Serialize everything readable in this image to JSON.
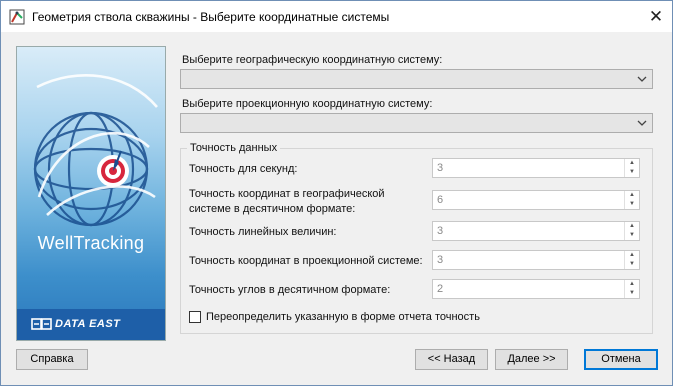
{
  "window": {
    "title": "Геометрия ствола скважины - Выберите координатные системы",
    "close_glyph": "✕"
  },
  "banner": {
    "brand": "WellTracking",
    "footer_logo": "DATA EAST"
  },
  "form": {
    "geo_label": "Выберите географическую координатную систему:",
    "geo_value": "",
    "proj_label": "Выберите проекционную координатную систему:",
    "proj_value": "",
    "group_title": "Точность данных",
    "fields": [
      {
        "label": "Точность для секунд:",
        "value": "3"
      },
      {
        "label": "Точность координат в географической",
        "label2": "системе в десятичном формате:",
        "value": "6"
      },
      {
        "label": "Точность линейных величин:",
        "value": "3"
      },
      {
        "label": "Точность координат в проекционной системе:",
        "value": "3"
      },
      {
        "label": "Точность углов в десятичном формате:",
        "value": "2"
      }
    ],
    "override_label": "Переопределить указанную в форме отчета точность",
    "override_checked": false
  },
  "buttons": {
    "help": "Справка",
    "back": "<< Назад",
    "next": "Далее >>",
    "cancel": "Отмена"
  },
  "colors": {
    "accent": "#0078d7",
    "banner_footer": "#1e5fa8",
    "target_red": "#d7263d"
  },
  "icons": [
    "app-icon",
    "close-icon",
    "chevron-down-icon",
    "spin-up-icon",
    "spin-down-icon",
    "globe-target-icon"
  ]
}
